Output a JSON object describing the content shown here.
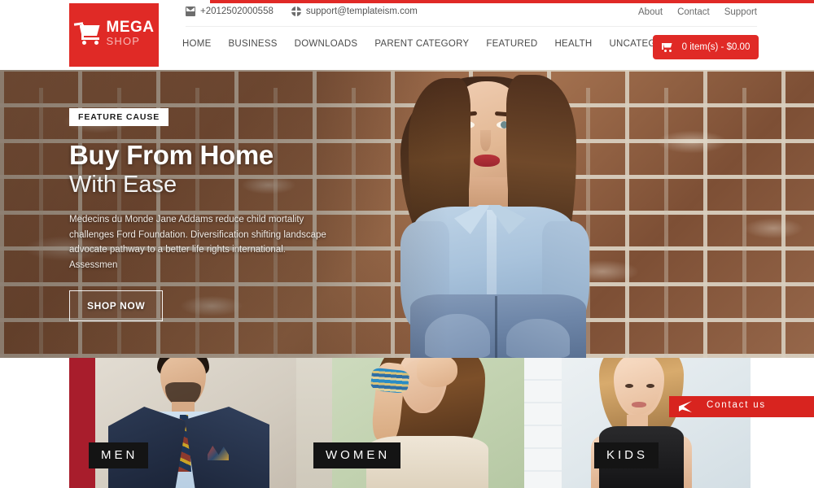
{
  "brand": {
    "name_primary": "MEGA",
    "name_secondary": "SHOP",
    "logo_icon": "shopping-cart-icon",
    "accent_color": "#e02a26"
  },
  "topbar": {
    "phone": "+2012502000558",
    "phone_icon": "mail-icon",
    "email": "support@templateism.com",
    "email_icon": "globe-icon",
    "links": [
      {
        "label": "About"
      },
      {
        "label": "Contact"
      },
      {
        "label": "Support"
      }
    ]
  },
  "nav": {
    "items": [
      {
        "label": "HOME"
      },
      {
        "label": "BUSINESS"
      },
      {
        "label": "DOWNLOADS"
      },
      {
        "label": "PARENT CATEGORY"
      },
      {
        "label": "FEATURED"
      },
      {
        "label": "HEALTH"
      },
      {
        "label": "UNCATEGORIZED"
      }
    ]
  },
  "cart": {
    "icon": "cart-icon",
    "label": "0 item(s) - $0.00",
    "items_count": 0,
    "total": "$0.00"
  },
  "hero": {
    "badge": "FEATURE CAUSE",
    "heading_bold": "Buy From Home",
    "heading_light": "With Ease",
    "paragraph": "Medecins du Monde Jane Addams reduce child mortality challenges Ford Foundation. Diversification shifting landscape advocate pathway to a better life rights international. Assessmen",
    "cta_label": "SHOP NOW"
  },
  "categories": [
    {
      "label": "MEN"
    },
    {
      "label": "WOMEN"
    },
    {
      "label": "KIDS"
    }
  ],
  "contact_tab": {
    "label": "Contact us",
    "icon": "paper-plane-icon",
    "color": "#d8241f"
  }
}
